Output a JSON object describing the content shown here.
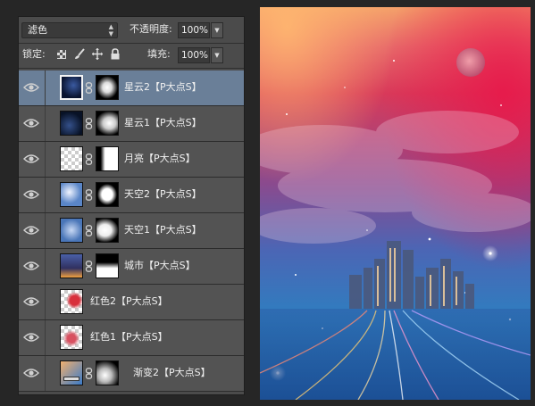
{
  "layers_panel": {
    "blend_mode": "滤色",
    "opacity_label": "不透明度:",
    "opacity_value": "100%",
    "lock_label": "锁定:",
    "fill_label": "填充:",
    "fill_value": "100%",
    "layers": [
      {
        "name": "星云2【P大点S】",
        "selected": true,
        "has_mask": true
      },
      {
        "name": "星云1【P大点S】",
        "selected": false,
        "has_mask": true
      },
      {
        "name": "月亮【P大点S】",
        "selected": false,
        "has_mask": true
      },
      {
        "name": "天空2【P大点S】",
        "selected": false,
        "has_mask": true
      },
      {
        "name": "天空1【P大点S】",
        "selected": false,
        "has_mask": true
      },
      {
        "name": "城市【P大点S】",
        "selected": false,
        "has_mask": true
      },
      {
        "name": "红色2【P大点S】",
        "selected": false,
        "has_mask": false
      },
      {
        "name": "红色1【P大点S】",
        "selected": false,
        "has_mask": false
      },
      {
        "name": "渐变2【P大点S】",
        "selected": false,
        "has_mask": true
      }
    ]
  },
  "colors": {
    "panel_bg": "#535353",
    "selected_bg": "#6a7f98",
    "canvas_top": "#f4a16a",
    "canvas_red": "#d83a5a",
    "canvas_blue": "#1a64b0"
  }
}
